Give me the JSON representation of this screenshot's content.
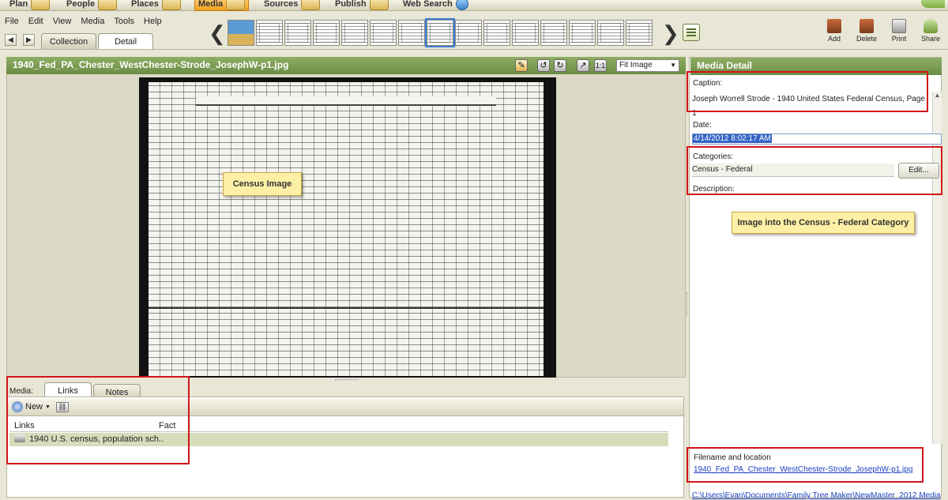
{
  "modules": [
    {
      "label": "Plan",
      "active": false
    },
    {
      "label": "People",
      "active": false
    },
    {
      "label": "Places",
      "active": false
    },
    {
      "label": "Media",
      "active": true
    },
    {
      "label": "Sources",
      "active": false
    },
    {
      "label": "Publish",
      "active": false
    },
    {
      "label": "Web Search",
      "active": false
    }
  ],
  "menu": [
    "File",
    "Edit",
    "View",
    "Media",
    "Tools",
    "Help"
  ],
  "view_tabs": {
    "collection": "Collection",
    "detail": "Detail"
  },
  "toolbar": {
    "add": "Add",
    "delete": "Delete",
    "print": "Print",
    "share": "Share"
  },
  "image_panel": {
    "title": "1940_Fed_PA_Chester_WestChester-Strode_JosephW-p1.jpg",
    "fit_select": "Fit Image",
    "actual_size": "1:1"
  },
  "callouts": {
    "census_image": "Census Image",
    "category_note": "Image into the Census - Federal Category"
  },
  "media_detail": {
    "header": "Media Detail",
    "caption_label": "Caption:",
    "caption_value": "Joseph Worrell Strode - 1940 United States Federal Census, Page 1",
    "date_label": "Date:",
    "date_value": "4/14/2012 8:02:17 AM",
    "categories_label": "Categories:",
    "categories_value": "Census - Federal",
    "edit_button": "Edit...",
    "description_label": "Description:",
    "filename_label": "Filename and location",
    "filename_value": "1940_Fed_PA_Chester_WestChester-Strode_JosephW-p1.jpg",
    "path_value": "C:\\Users\\Evan\\Documents\\Family Tree Maker\\NewMaster_2012 Media"
  },
  "media_links": {
    "media_label": "Media:",
    "tab_links": "Links",
    "tab_notes": "Notes",
    "new_button": "New",
    "col_links": "Links",
    "col_fact": "Fact",
    "row_link": "1940 U.S. census, population sch.."
  },
  "colors": {
    "accent_green": "#7a9b52",
    "annotation_red": "#d2141a",
    "callout_yellow": "#fdf0a6",
    "selection_blue": "#3b7fd6"
  }
}
